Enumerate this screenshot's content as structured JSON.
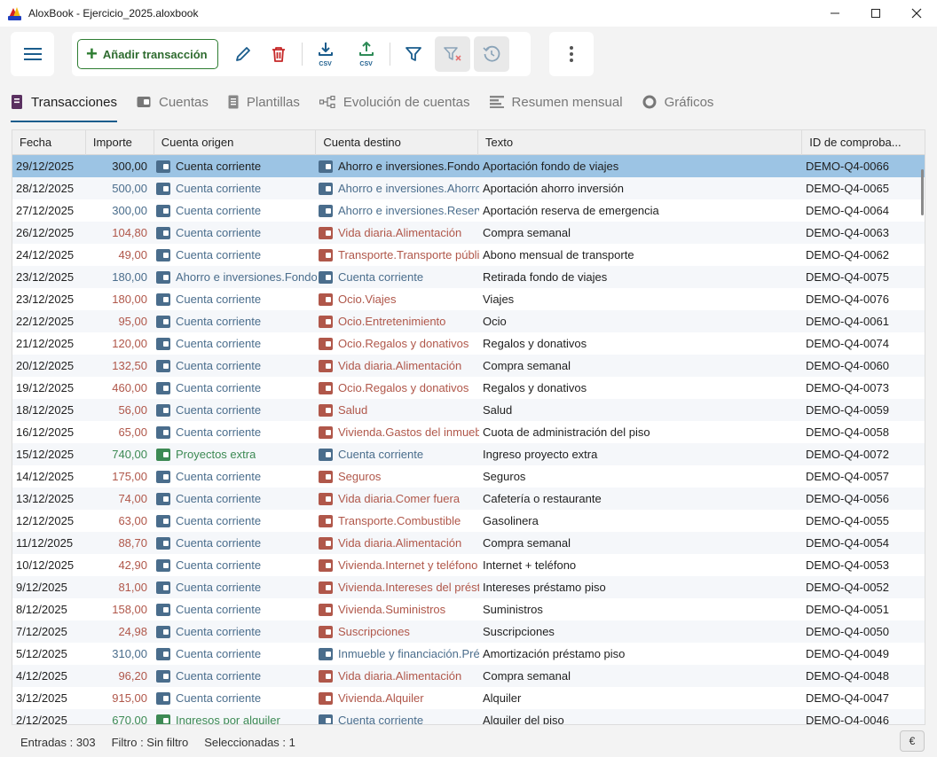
{
  "window": {
    "title": "AloxBook - Ejercicio_2025.aloxbook"
  },
  "toolbar": {
    "add_label": "Añadir transacción",
    "csv_label": "CSV"
  },
  "tabs": [
    {
      "label": "Transacciones",
      "icon": "book-icon",
      "active": true
    },
    {
      "label": "Cuentas",
      "icon": "wallet-icon"
    },
    {
      "label": "Plantillas",
      "icon": "document-icon"
    },
    {
      "label": "Evolución de cuentas",
      "icon": "tree-icon"
    },
    {
      "label": "Resumen mensual",
      "icon": "list-icon"
    },
    {
      "label": "Gráficos",
      "icon": "donut-icon"
    }
  ],
  "columns": [
    "Fecha",
    "Importe",
    "Cuenta origen",
    "Cuenta destino",
    "Texto",
    "ID de comproba..."
  ],
  "rows": [
    {
      "date": "29/12/2025",
      "amount": "300,00",
      "atype": "transfer",
      "src": "Cuenta corriente",
      "stype": "asset",
      "dst": "Ahorro e inversiones.Fondo de viajes",
      "dtype": "asset",
      "text": "Aportación fondo de viajes",
      "id": "DEMO-Q4-0066",
      "selected": true
    },
    {
      "date": "28/12/2025",
      "amount": "500,00",
      "atype": "transfer",
      "src": "Cuenta corriente",
      "stype": "asset",
      "dst": "Ahorro e inversiones.Ahorro inversión",
      "dtype": "asset",
      "text": "Aportación ahorro inversión",
      "id": "DEMO-Q4-0065"
    },
    {
      "date": "27/12/2025",
      "amount": "300,00",
      "atype": "transfer",
      "src": "Cuenta corriente",
      "stype": "asset",
      "dst": "Ahorro e inversiones.Reserva de emergencia",
      "dtype": "asset",
      "text": "Aportación reserva de emergencia",
      "id": "DEMO-Q4-0064"
    },
    {
      "date": "26/12/2025",
      "amount": "104,80",
      "atype": "expense",
      "src": "Cuenta corriente",
      "stype": "asset",
      "dst": "Vida diaria.Alimentación",
      "dtype": "expense",
      "text": "Compra semanal",
      "id": "DEMO-Q4-0063"
    },
    {
      "date": "24/12/2025",
      "amount": "49,00",
      "atype": "expense",
      "src": "Cuenta corriente",
      "stype": "asset",
      "dst": "Transporte.Transporte público",
      "dtype": "expense",
      "text": "Abono mensual de transporte",
      "id": "DEMO-Q4-0062"
    },
    {
      "date": "23/12/2025",
      "amount": "180,00",
      "atype": "transfer",
      "src": "Ahorro e inversiones.Fondo de viajes",
      "stype": "asset",
      "dst": "Cuenta corriente",
      "dtype": "asset",
      "text": "Retirada fondo de viajes",
      "id": "DEMO-Q4-0075"
    },
    {
      "date": "23/12/2025",
      "amount": "180,00",
      "atype": "expense",
      "src": "Cuenta corriente",
      "stype": "asset",
      "dst": "Ocio.Viajes",
      "dtype": "expense",
      "text": "Viajes",
      "id": "DEMO-Q4-0076"
    },
    {
      "date": "22/12/2025",
      "amount": "95,00",
      "atype": "expense",
      "src": "Cuenta corriente",
      "stype": "asset",
      "dst": "Ocio.Entretenimiento",
      "dtype": "expense",
      "text": "Ocio",
      "id": "DEMO-Q4-0061"
    },
    {
      "date": "21/12/2025",
      "amount": "120,00",
      "atype": "expense",
      "src": "Cuenta corriente",
      "stype": "asset",
      "dst": "Ocio.Regalos y donativos",
      "dtype": "expense",
      "text": "Regalos y donativos",
      "id": "DEMO-Q4-0074"
    },
    {
      "date": "20/12/2025",
      "amount": "132,50",
      "atype": "expense",
      "src": "Cuenta corriente",
      "stype": "asset",
      "dst": "Vida diaria.Alimentación",
      "dtype": "expense",
      "text": "Compra semanal",
      "id": "DEMO-Q4-0060"
    },
    {
      "date": "19/12/2025",
      "amount": "460,00",
      "atype": "expense",
      "src": "Cuenta corriente",
      "stype": "asset",
      "dst": "Ocio.Regalos y donativos",
      "dtype": "expense",
      "text": "Regalos y donativos",
      "id": "DEMO-Q4-0073"
    },
    {
      "date": "18/12/2025",
      "amount": "56,00",
      "atype": "expense",
      "src": "Cuenta corriente",
      "stype": "asset",
      "dst": "Salud",
      "dtype": "expense",
      "text": "Salud",
      "id": "DEMO-Q4-0059"
    },
    {
      "date": "16/12/2025",
      "amount": "65,00",
      "atype": "expense",
      "src": "Cuenta corriente",
      "stype": "asset",
      "dst": "Vivienda.Gastos del inmueble",
      "dtype": "expense",
      "text": "Cuota de administración del piso",
      "id": "DEMO-Q4-0058"
    },
    {
      "date": "15/12/2025",
      "amount": "740,00",
      "atype": "income",
      "src": "Proyectos extra",
      "stype": "income",
      "dst": "Cuenta corriente",
      "dtype": "asset",
      "text": "Ingreso proyecto extra",
      "id": "DEMO-Q4-0072"
    },
    {
      "date": "14/12/2025",
      "amount": "175,00",
      "atype": "expense",
      "src": "Cuenta corriente",
      "stype": "asset",
      "dst": "Seguros",
      "dtype": "expense",
      "text": "Seguros",
      "id": "DEMO-Q4-0057"
    },
    {
      "date": "13/12/2025",
      "amount": "74,00",
      "atype": "expense",
      "src": "Cuenta corriente",
      "stype": "asset",
      "dst": "Vida diaria.Comer fuera",
      "dtype": "expense",
      "text": "Cafetería o restaurante",
      "id": "DEMO-Q4-0056"
    },
    {
      "date": "12/12/2025",
      "amount": "63,00",
      "atype": "expense",
      "src": "Cuenta corriente",
      "stype": "asset",
      "dst": "Transporte.Combustible",
      "dtype": "expense",
      "text": "Gasolinera",
      "id": "DEMO-Q4-0055"
    },
    {
      "date": "11/12/2025",
      "amount": "88,70",
      "atype": "expense",
      "src": "Cuenta corriente",
      "stype": "asset",
      "dst": "Vida diaria.Alimentación",
      "dtype": "expense",
      "text": "Compra semanal",
      "id": "DEMO-Q4-0054"
    },
    {
      "date": "10/12/2025",
      "amount": "42,90",
      "atype": "expense",
      "src": "Cuenta corriente",
      "stype": "asset",
      "dst": "Vivienda.Internet y teléfono",
      "dtype": "expense",
      "text": "Internet + teléfono",
      "id": "DEMO-Q4-0053"
    },
    {
      "date": "9/12/2025",
      "amount": "81,00",
      "atype": "expense",
      "src": "Cuenta corriente",
      "stype": "asset",
      "dst": "Vivienda.Intereses del préstamo",
      "dtype": "expense",
      "text": "Intereses préstamo piso",
      "id": "DEMO-Q4-0052"
    },
    {
      "date": "8/12/2025",
      "amount": "158,00",
      "atype": "expense",
      "src": "Cuenta corriente",
      "stype": "asset",
      "dst": "Vivienda.Suministros",
      "dtype": "expense",
      "text": "Suministros",
      "id": "DEMO-Q4-0051"
    },
    {
      "date": "7/12/2025",
      "amount": "24,98",
      "atype": "expense",
      "src": "Cuenta corriente",
      "stype": "asset",
      "dst": "Suscripciones",
      "dtype": "expense",
      "text": "Suscripciones",
      "id": "DEMO-Q4-0050"
    },
    {
      "date": "5/12/2025",
      "amount": "310,00",
      "atype": "transfer",
      "src": "Cuenta corriente",
      "stype": "asset",
      "dst": "Inmueble y financiación.Préstamo",
      "dtype": "asset",
      "text": "Amortización préstamo piso",
      "id": "DEMO-Q4-0049"
    },
    {
      "date": "4/12/2025",
      "amount": "96,20",
      "atype": "expense",
      "src": "Cuenta corriente",
      "stype": "asset",
      "dst": "Vida diaria.Alimentación",
      "dtype": "expense",
      "text": "Compra semanal",
      "id": "DEMO-Q4-0048"
    },
    {
      "date": "3/12/2025",
      "amount": "915,00",
      "atype": "expense",
      "src": "Cuenta corriente",
      "stype": "asset",
      "dst": "Vivienda.Alquiler",
      "dtype": "expense",
      "text": "Alquiler",
      "id": "DEMO-Q4-0047"
    },
    {
      "date": "2/12/2025",
      "amount": "670,00",
      "atype": "income",
      "src": "Ingresos por alquiler",
      "stype": "income",
      "dst": "Cuenta corriente",
      "dtype": "asset",
      "text": "Alquiler del piso",
      "id": "DEMO-Q4-0046"
    }
  ],
  "status": {
    "entries": "Entradas : 303",
    "filter": "Filtro : Sin filtro",
    "selected": "Seleccionadas : 1",
    "currency": "€"
  },
  "colors": {
    "asset": "#4a6d8c",
    "expense": "#b0574a",
    "income": "#3d8a54",
    "accent": "#1a5c8c",
    "selected_row": "#9cc4e4"
  }
}
